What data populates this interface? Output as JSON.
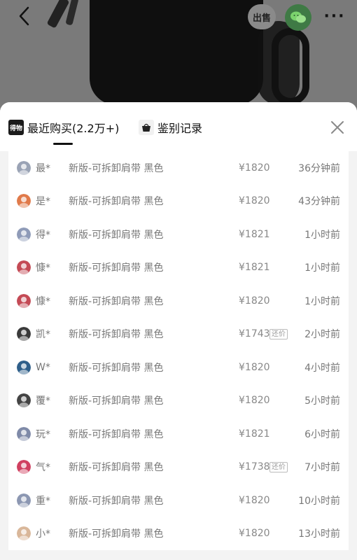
{
  "header": {
    "sell_label": "出售",
    "back_icon": "chevron-left-icon",
    "wechat_icon": "wechat-icon",
    "more_icon": "more-dots-icon",
    "more_label": "···"
  },
  "sheet": {
    "tabs": [
      {
        "label": "最近购买(2.2万+)",
        "icon": "dewu-logo-icon",
        "icon_text": "得物"
      },
      {
        "label": "鉴别记录",
        "icon": "bag-icon"
      }
    ],
    "close_icon": "close-icon"
  },
  "purchases": [
    {
      "user": "最*",
      "product": "新版-可拆卸肩带 黑色",
      "price": "¥1820",
      "badge": "",
      "time": "36分钟前",
      "avatar_color": "#9aa3b5"
    },
    {
      "user": "是*",
      "product": "新版-可拆卸肩带 黑色",
      "price": "¥1820",
      "badge": "",
      "time": "43分钟前",
      "avatar_color": "#e07a4a"
    },
    {
      "user": "得*",
      "product": "新版-可拆卸肩带 黑色",
      "price": "¥1821",
      "badge": "",
      "time": "1小时前",
      "avatar_color": "#8f9bb8"
    },
    {
      "user": "慷*",
      "product": "新版-可拆卸肩带 黑色",
      "price": "¥1821",
      "badge": "",
      "time": "1小时前",
      "avatar_color": "#c44a55"
    },
    {
      "user": "慷*",
      "product": "新版-可拆卸肩带 黑色",
      "price": "¥1820",
      "badge": "",
      "time": "1小时前",
      "avatar_color": "#c44a55"
    },
    {
      "user": "凯*",
      "product": "新版-可拆卸肩带 黑色",
      "price": "¥1743",
      "badge": "还价",
      "time": "2小时前",
      "avatar_color": "#3a3a3a"
    },
    {
      "user": "W*",
      "product": "新版-可拆卸肩带 黑色",
      "price": "¥1820",
      "badge": "",
      "time": "4小时前",
      "avatar_color": "#2f5f8a"
    },
    {
      "user": "覆*",
      "product": "新版-可拆卸肩带 黑色",
      "price": "¥1820",
      "badge": "",
      "time": "5小时前",
      "avatar_color": "#444444"
    },
    {
      "user": "玩*",
      "product": "新版-可拆卸肩带 黑色",
      "price": "¥1821",
      "badge": "",
      "time": "6小时前",
      "avatar_color": "#7f8aa8"
    },
    {
      "user": "气*",
      "product": "新版-可拆卸肩带 黑色",
      "price": "¥1738",
      "badge": "还价",
      "time": "7小时前",
      "avatar_color": "#d04060"
    },
    {
      "user": "重*",
      "product": "新版-可拆卸肩带 黑色",
      "price": "¥1820",
      "badge": "",
      "time": "10小时前",
      "avatar_color": "#8c97b2"
    },
    {
      "user": "小*",
      "product": "新版-可拆卸肩带 黑色",
      "price": "¥1820",
      "badge": "",
      "time": "13小时前",
      "avatar_color": "#d9b79a"
    }
  ]
}
